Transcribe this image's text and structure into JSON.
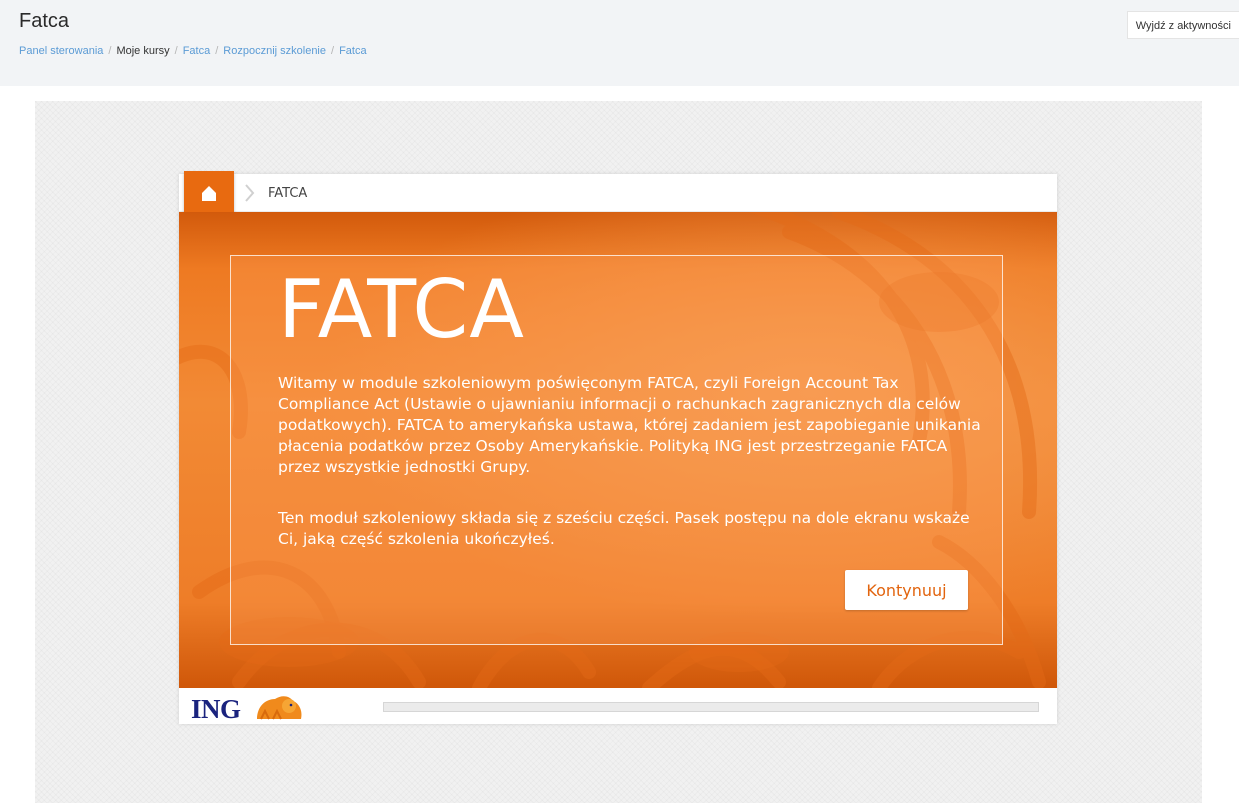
{
  "page": {
    "title": "Fatca",
    "exit_button_label": "Wyjdź z aktywności"
  },
  "breadcrumb": {
    "items": [
      {
        "label": "Panel sterowania"
      },
      {
        "label": "Moje kursy"
      },
      {
        "label": "Fatca"
      },
      {
        "label": "Rozpocznij szkolenie"
      },
      {
        "label": "Fatca"
      }
    ],
    "separator": "/"
  },
  "course": {
    "nav_label": "FATCA",
    "heading": "FATCA",
    "paragraph_1": "Witamy w module szkoleniowym poświęconym FATCA, czyli Foreign Account Tax Compliance Act (Ustawie o ujawnianiu informacji o rachunkach zagranicznych dla celów podatkowych).  FATCA to amerykańska ustawa, której zadaniem jest zapobieganie unikania płacenia podatków przez Osoby Amerykańskie. Polityką ING jest przestrzeganie FATCA przez wszystkie jednostki Grupy.",
    "paragraph_2": "Ten moduł szkoleniowy składa się z sześciu części. Pasek postępu na dole ekranu wskaże Ci, jaką część szkolenia ukończyłeś.",
    "continue_label": "Kontynuuj",
    "logo_text": "ING",
    "progress": 0
  },
  "colors": {
    "accent": "#e86a10",
    "link": "#5b9bd5",
    "brand_blue": "#1a237e"
  },
  "icons": {
    "home": "home-icon",
    "chevron": "chevron-right-icon",
    "lion": "ing-lion-icon"
  }
}
